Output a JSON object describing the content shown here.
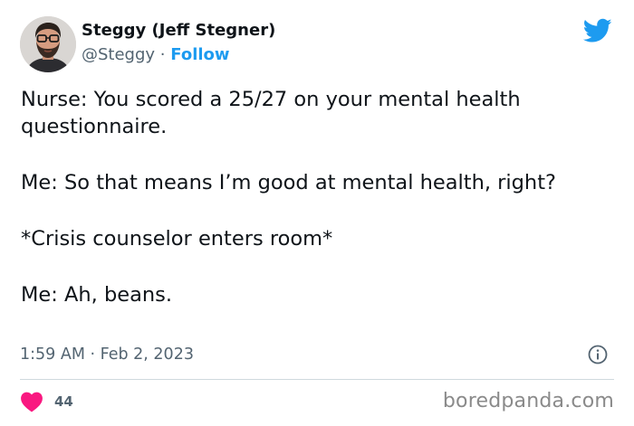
{
  "author": {
    "display_name": "Steggy (Jeff Stegner)",
    "handle": "@Steggy",
    "separator": "·",
    "follow_label": "Follow",
    "avatar_icon": "bearded-man-avatar"
  },
  "brand": {
    "logo_icon": "twitter-bird-icon",
    "color": "#1d9bf0"
  },
  "tweet": {
    "paragraphs": [
      "Nurse: You scored a 25/27 on your mental health questionnaire.",
      "Me: So that means I’m good at mental health, right?",
      "*Crisis counselor enters room*",
      "Me: Ah, beans."
    ],
    "timestamp": "1:59 AM · Feb 2, 2023"
  },
  "engagement": {
    "like_icon": "heart-icon",
    "like_color": "#f91880",
    "like_count": "44",
    "info_icon": "info-icon"
  },
  "watermark": "boredpanda.com"
}
